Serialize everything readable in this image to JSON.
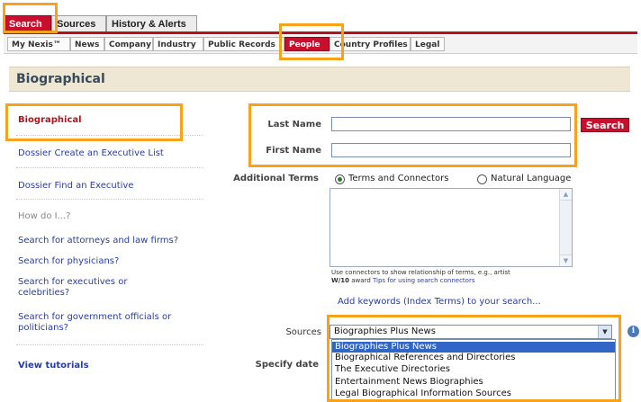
{
  "top_tabs": [
    "Search",
    "Sources",
    "History & Alerts"
  ],
  "sub_tabs": [
    "My Nexis™",
    "News",
    "Company",
    "Industry",
    "Public Records",
    "People",
    "Country Profiles",
    "Legal"
  ],
  "section_title": "Biographical",
  "nav": {
    "biographical": "Biographical",
    "dossier_create": "Dossier Create an Executive List",
    "dossier_find": "Dossier Find an Executive",
    "how_do_i": "How do I...?",
    "q1": "Search for attorneys and law firms?",
    "q2": "Search for physicians?",
    "q3a": "Search for executives or",
    "q3b": "celebrities?",
    "q4a": "Search for government officials or",
    "q4b": "politicians?",
    "tutorials": "View tutorials"
  },
  "form": {
    "last_name_label": "Last Name",
    "first_name_label": "First Name",
    "last_name_value": "",
    "first_name_value": "",
    "search_button": "Search",
    "additional_terms_label": "Additional Terms",
    "radio_terms": "Terms and Connectors",
    "radio_natural": "Natural Language",
    "selected_mode": "Terms and Connectors",
    "tip_line1": "Use connectors to show relationship of terms, e.g., artist",
    "tip_bold": "W/10",
    "tip_award": " award ",
    "tip_link": "Tips for using search connectors",
    "add_keywords": "Add keywords (Index Terms) to your search...",
    "sources_label": "Sources",
    "specify_date_label": "Specify date",
    "sources_selected": "Biographies Plus News",
    "sources_options": [
      "Biographies Plus News",
      "Biographical References and Directories",
      "The Executive Directories",
      "Entertainment News Biographies",
      "Legal Biographical Information Sources"
    ]
  },
  "colors": {
    "accent_red": "#c8102e",
    "highlight_orange": "#f7a21b",
    "link_blue": "#2a3d9e",
    "header_bg": "#ede7d4"
  },
  "icons": {
    "info": "info-icon",
    "select_arrow": "chevron-down-icon"
  }
}
